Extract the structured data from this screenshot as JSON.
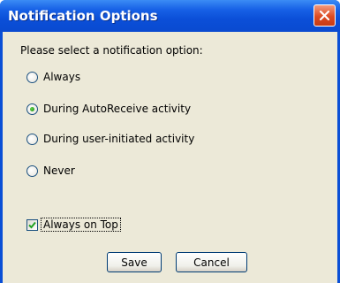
{
  "window": {
    "title": "Notification Options"
  },
  "prompt": "Please select a notification option:",
  "options": [
    {
      "label": "Always",
      "selected": false
    },
    {
      "label": "During AutoReceive activity",
      "selected": true
    },
    {
      "label": "During user-initiated activity",
      "selected": false
    },
    {
      "label": "Never",
      "selected": false
    }
  ],
  "always_on_top": {
    "label": "Always on Top",
    "checked": true
  },
  "buttons": {
    "save": "Save",
    "cancel": "Cancel"
  },
  "colors": {
    "titlebar": "#0a4fd6",
    "client_bg": "#ece9d8",
    "close_button": "#dc4b23",
    "selection_green": "#1f8a14"
  },
  "icons": {
    "close": "close-icon",
    "checkmark": "checkmark-icon"
  }
}
